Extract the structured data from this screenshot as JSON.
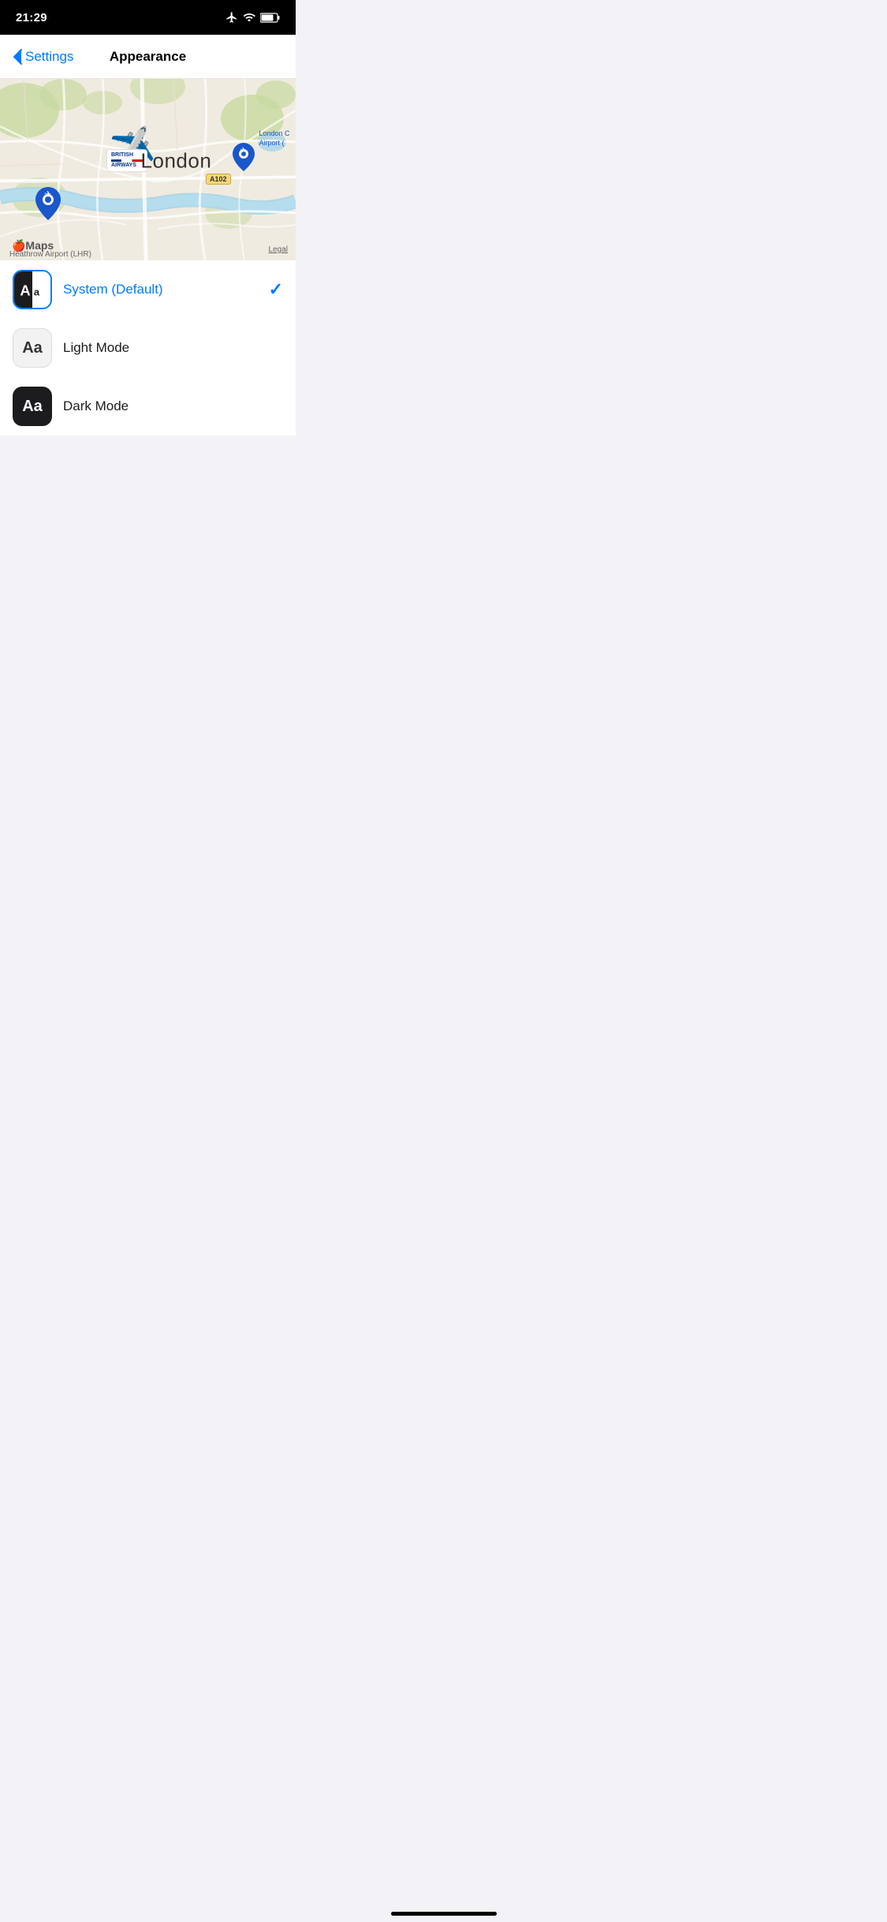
{
  "statusBar": {
    "time": "21:29"
  },
  "navBar": {
    "backLabel": "Settings",
    "title": "Appearance"
  },
  "map": {
    "londonLabel": "London",
    "airportLabel": "London City Airport (",
    "heathrowLabel": "Heathrow Airport (LHR)",
    "legalLabel": "Legal",
    "roadBadge": "A102",
    "mapsLabel": "Maps",
    "baName": "BRITISH",
    "baName2": "AIRWAYS"
  },
  "appearanceOptions": [
    {
      "id": "system",
      "label": "System (Default)",
      "labelColor": "blue",
      "iconType": "system",
      "selected": true
    },
    {
      "id": "light",
      "label": "Light Mode",
      "labelColor": "dark",
      "iconType": "light",
      "selected": false
    },
    {
      "id": "dark",
      "label": "Dark Mode",
      "labelColor": "dark",
      "iconType": "dark",
      "selected": false
    }
  ]
}
